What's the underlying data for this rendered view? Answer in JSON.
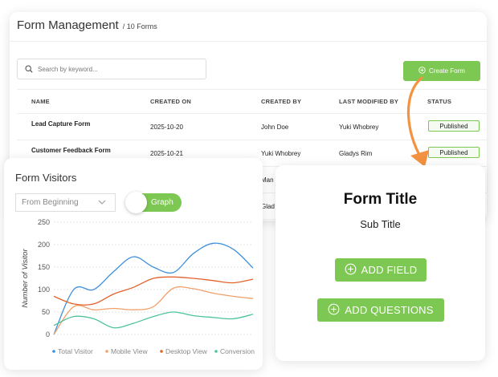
{
  "management": {
    "title": "Form Management",
    "count": "/ 10 Forms",
    "search_placeholder": "Search by keyword...",
    "create_button": "Create Form",
    "columns": [
      "NAME",
      "CREATED ON",
      "CREATED BY",
      "LAST MODIFIED BY",
      "STATUS"
    ],
    "rows": [
      {
        "name": "Lead Capture Form",
        "created_on": "2025-10-20",
        "created_by": "John Doe",
        "modified_by": "Yuki Whobrey",
        "status": "Published"
      },
      {
        "name": "Customer Feedback Form",
        "created_on": "2025-10-21",
        "created_by": "Yuki Whobrey",
        "modified_by": "Gladys Rim",
        "status": "Published"
      },
      {
        "name": "",
        "created_on": "",
        "created_by": "Man",
        "modified_by": "",
        "status": ""
      },
      {
        "name": "",
        "created_on": "",
        "created_by": "Glad",
        "modified_by": "",
        "status": ""
      }
    ]
  },
  "visitors": {
    "title": "Form Visitors",
    "range_select": "From Beginning",
    "view_toggle": "Graph"
  },
  "preview": {
    "title": "Form Title",
    "subtitle": "Sub Title",
    "add_field": "ADD FIELD",
    "add_questions": "ADD QUESTIONS"
  },
  "colors": {
    "accent_green": "#7dc852",
    "arrow_orange": "#f39240",
    "total_visitor": "#3d8fdc",
    "mobile_view": "#f0a06a",
    "desktop_view": "#e2622a",
    "conversion": "#4cc39e"
  },
  "chart_data": {
    "type": "line",
    "ylabel": "Number of Visitor",
    "ylim": [
      0,
      250
    ],
    "yticks": [
      0,
      50,
      100,
      150,
      200,
      250
    ],
    "grid": true,
    "legend_position": "bottom",
    "x": [
      0,
      1,
      2,
      3,
      4,
      5,
      6,
      7,
      8,
      9,
      10
    ],
    "series": [
      {
        "name": "Total Visitor",
        "color": "#3d8fdc",
        "values": [
          0,
          100,
          100,
          140,
          173,
          150,
          138,
          180,
          203,
          190,
          148
        ]
      },
      {
        "name": "Mobile View",
        "color": "#f0a06a",
        "values": [
          0,
          62,
          55,
          58,
          55,
          62,
          103,
          102,
          92,
          85,
          80
        ]
      },
      {
        "name": "Desktop View",
        "color": "#e2622a",
        "values": [
          85,
          68,
          68,
          90,
          105,
          125,
          128,
          125,
          120,
          115,
          123
        ]
      },
      {
        "name": "Conversion",
        "color": "#4cc39e",
        "values": [
          20,
          40,
          35,
          15,
          25,
          40,
          50,
          42,
          38,
          35,
          45
        ]
      }
    ]
  }
}
